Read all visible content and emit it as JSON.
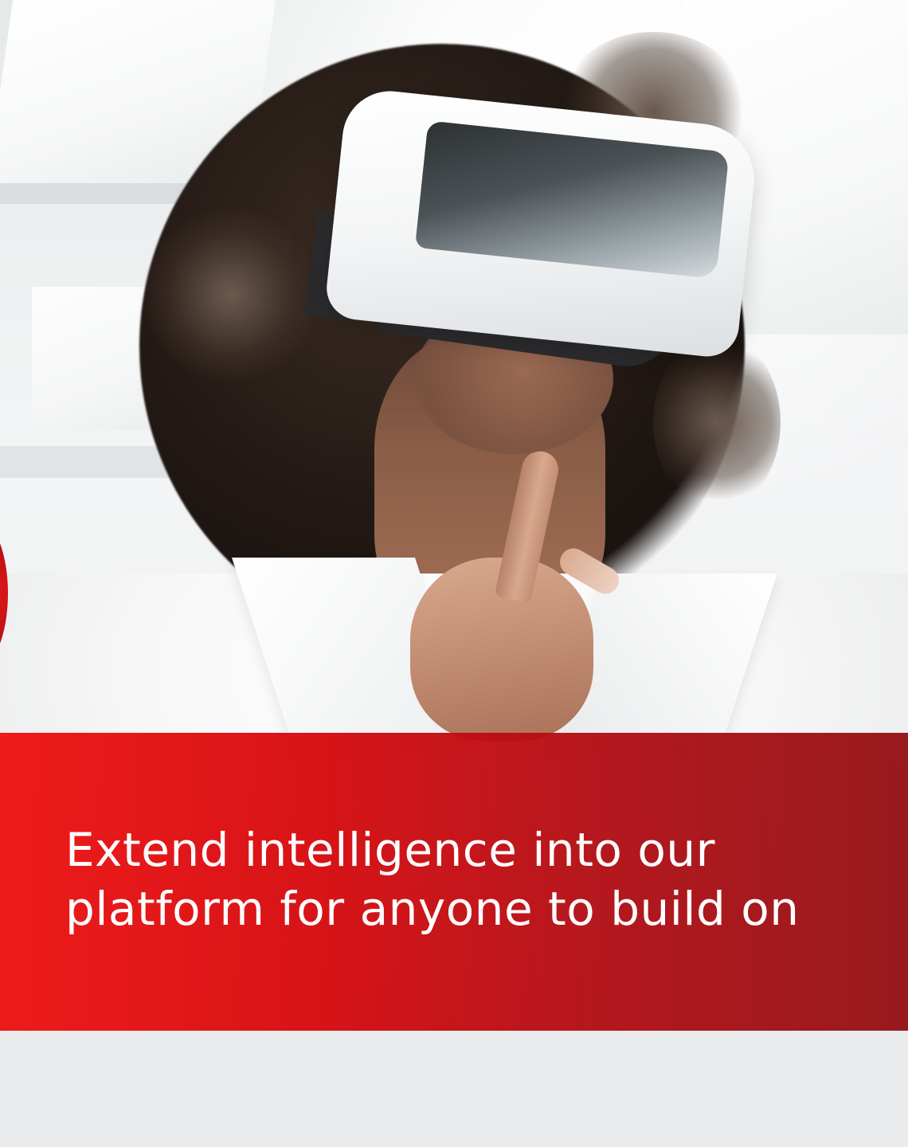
{
  "banner": {
    "line1": "Extend intelligence into our",
    "line2": "platform for anyone to build on"
  },
  "colors": {
    "banner_red_start": "#ee1414",
    "banner_red_end": "#941216",
    "text": "#ffffff"
  }
}
